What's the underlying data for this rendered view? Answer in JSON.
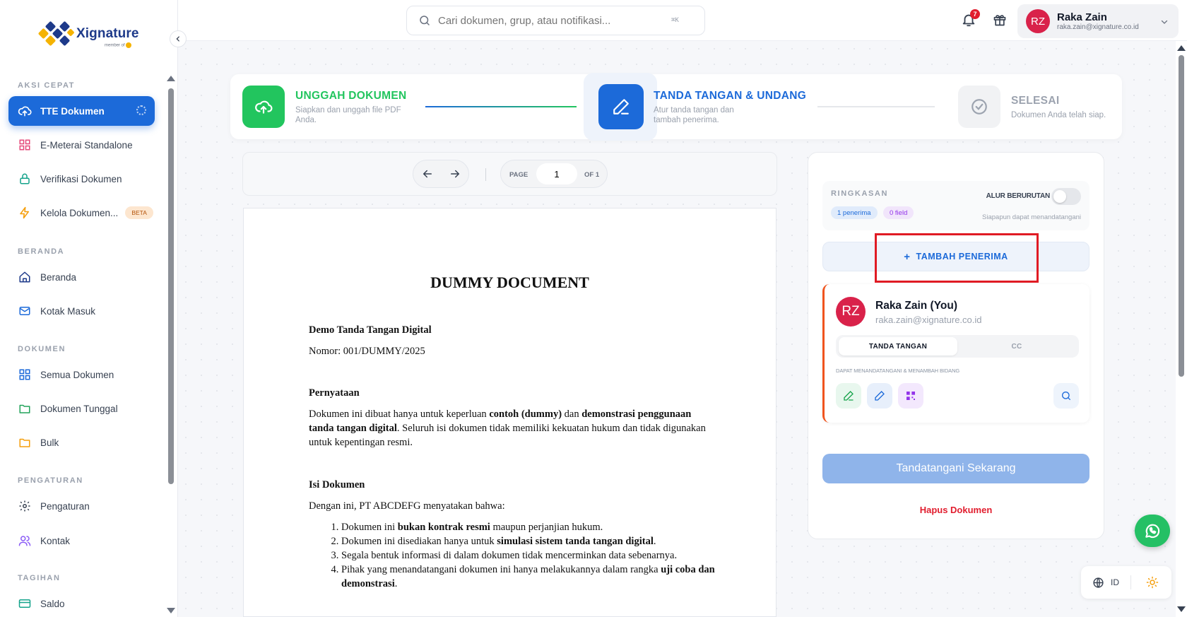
{
  "brand": {
    "name": "Xignature",
    "sub": "member of"
  },
  "sidebar": {
    "sections": [
      {
        "label": "AKSI CEPAT"
      },
      {
        "label": "BERANDA"
      },
      {
        "label": "DOKUMEN"
      },
      {
        "label": "PENGATURAN"
      },
      {
        "label": "TAGIHAN"
      }
    ],
    "items": [
      {
        "label": "TTE Dokumen",
        "icon": "cloud-upload-icon"
      },
      {
        "label": "E-Meterai Standalone",
        "icon": "grid-icon"
      },
      {
        "label": "Verifikasi Dokumen",
        "icon": "lock-icon"
      },
      {
        "label": "Kelola Dokumen...",
        "icon": "bolt-icon",
        "badge": "BETA"
      },
      {
        "label": "Beranda",
        "icon": "home-icon"
      },
      {
        "label": "Kotak Masuk",
        "icon": "mail-icon"
      },
      {
        "label": "Semua Dokumen",
        "icon": "grid-icon"
      },
      {
        "label": "Dokumen Tunggal",
        "icon": "folder-icon"
      },
      {
        "label": "Bulk",
        "icon": "folder-icon"
      },
      {
        "label": "Pengaturan",
        "icon": "gear-icon"
      },
      {
        "label": "Kontak",
        "icon": "users-icon"
      },
      {
        "label": "Saldo",
        "icon": "card-icon"
      }
    ]
  },
  "topbar": {
    "search_placeholder": "Cari dokumen, grup, atau notifikasi...",
    "shortcut": "⌘K",
    "notif_count": "7",
    "user": {
      "initials": "RZ",
      "name": "Raka Zain",
      "email": "raka.zain@xignature.co.id"
    }
  },
  "stepper": {
    "steps": [
      {
        "title": "UNGGAH DOKUMEN",
        "desc1": "Siapkan dan unggah file PDF",
        "desc2": "Anda.",
        "color": "#22c55e"
      },
      {
        "title": "TANDA TANGAN & UNDANG",
        "desc1": "Atur tanda tangan dan",
        "desc2": "tambah penerima.",
        "color": "#1c6ad9"
      },
      {
        "title": "SELESAI",
        "desc1": "Dokumen Anda telah siap.",
        "desc2": "",
        "color": "#9ca3af"
      }
    ]
  },
  "pager": {
    "page_label": "PAGE",
    "page_value": "1",
    "of_label": "OF 1"
  },
  "document": {
    "title": "DUMMY DOCUMENT",
    "heading": "Demo Tanda Tangan Digital",
    "number": "Nomor: 001/DUMMY/2025",
    "sec1_title": "Pernyataan",
    "sec1_body_a": "Dokumen ini dibuat hanya untuk keperluan ",
    "sec1_bold_a": "contoh (dummy)",
    "sec1_body_b": " dan ",
    "sec1_bold_b": "demonstrasi penggunaan tanda tangan digital",
    "sec1_body_c": ". Seluruh isi dokumen tidak memiliki kekuatan hukum dan tidak digunakan untuk kepentingan resmi.",
    "sec2_title": "Isi Dokumen",
    "sec2_intro": "Dengan ini, PT ABCDEFG menyatakan bahwa:",
    "list": [
      {
        "pre": "Dokumen ini ",
        "bold": "bukan kontrak resmi",
        "post": " maupun perjanjian hukum."
      },
      {
        "pre": "Dokumen ini disediakan hanya untuk ",
        "bold": "simulasi sistem tanda tangan digital",
        "post": "."
      },
      {
        "pre": "Segala bentuk informasi di dalam dokumen tidak mencerminkan data sebenarnya.",
        "bold": "",
        "post": ""
      },
      {
        "pre": "Pihak yang menandatangani dokumen ini hanya melakukannya dalam rangka ",
        "bold": "uji coba dan demonstrasi",
        "post": "."
      }
    ]
  },
  "panel": {
    "summary_title": "RINGKASAN",
    "chip_recipients": "1 penerima",
    "chip_fields": "0 field",
    "sequential_label": "ALUR BERURUTAN",
    "sequential_sub": "Siapapun dapat menandatangani",
    "add_recipient": "TAMBAH PENERIMA",
    "recipient": {
      "initials": "RZ",
      "name": "Raka Zain (You)",
      "email": "raka.zain@xignature.co.id",
      "tab_sign": "TANDA TANGAN",
      "tab_cc": "CC",
      "caption": "DAPAT MENANDATANGANI & MENAMBAH BIDANG"
    },
    "sign_now": "Tandatangani Sekarang",
    "delete": "Hapus Dokumen"
  },
  "footer": {
    "language": "ID"
  }
}
